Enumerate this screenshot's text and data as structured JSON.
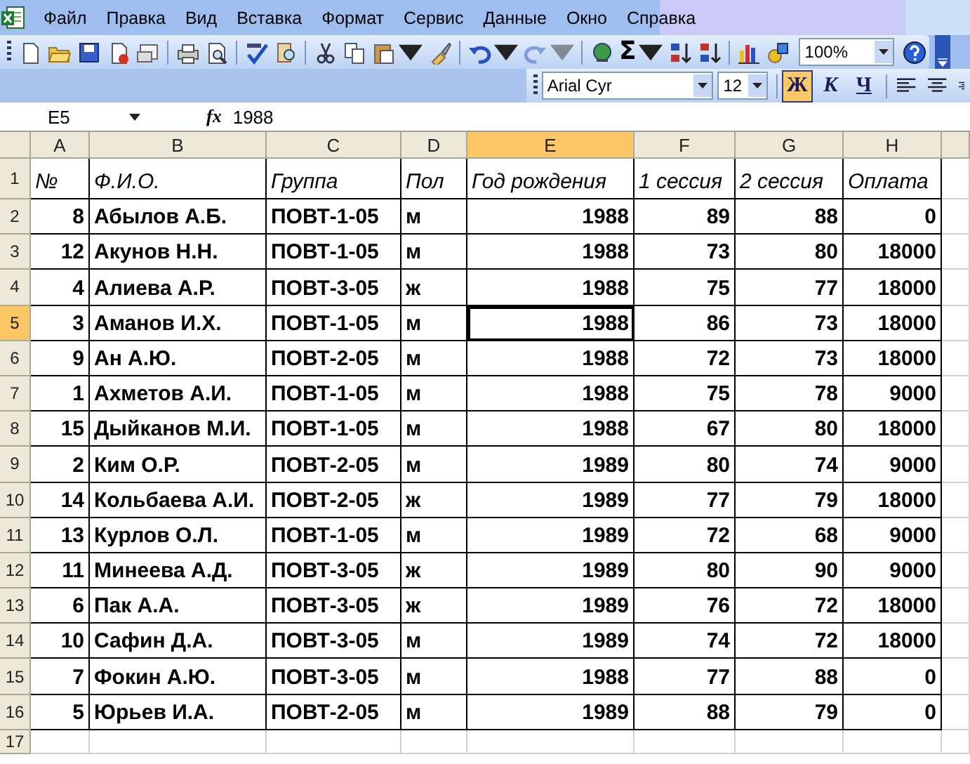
{
  "menu": [
    "Файл",
    "Правка",
    "Вид",
    "Вставка",
    "Формат",
    "Сервис",
    "Данные",
    "Окно",
    "Справка"
  ],
  "standard_toolbar": {
    "sum_symbol": "Σ",
    "redo": {
      "disabled": true
    },
    "zoom": "100%"
  },
  "formatting_toolbar": {
    "font": "Arial Cyr",
    "size": "12",
    "styles": [
      {
        "label": "Ж",
        "kind": "bold",
        "selected": true
      },
      {
        "label": "К",
        "kind": "italic",
        "selected": false
      },
      {
        "label": "Ч",
        "kind": "underline",
        "selected": false
      }
    ]
  },
  "formula_bar": {
    "name_box": "E5",
    "fx": "fx",
    "formula": "1988"
  },
  "columns": [
    {
      "label": "A",
      "numeric": true,
      "selected": false
    },
    {
      "label": "B",
      "numeric": false,
      "selected": false
    },
    {
      "label": "C",
      "numeric": false,
      "selected": false
    },
    {
      "label": "D",
      "numeric": false,
      "selected": false
    },
    {
      "label": "E",
      "numeric": true,
      "selected": true
    },
    {
      "label": "F",
      "numeric": true,
      "selected": false
    },
    {
      "label": "G",
      "numeric": true,
      "selected": false
    },
    {
      "label": "H",
      "numeric": true,
      "selected": false
    },
    {
      "selected": false
    }
  ],
  "rows": [
    {
      "header": "1",
      "kind": "header",
      "selected": false,
      "cells": [
        "№",
        "Ф.И.О.",
        "Группа",
        "Пол",
        "Год рождения",
        "1 сессия",
        "2 сессия",
        "Оплата"
      ]
    },
    {
      "header": "2",
      "kind": "data",
      "selected": false,
      "cells": [
        "8",
        "Абылов А.Б.",
        "ПОВТ-1-05",
        "м",
        "1988",
        "89",
        "88",
        "0"
      ]
    },
    {
      "header": "3",
      "kind": "data",
      "selected": false,
      "cells": [
        "12",
        "Акунов Н.Н.",
        "ПОВТ-1-05",
        "м",
        "1988",
        "73",
        "80",
        "18000"
      ]
    },
    {
      "header": "4",
      "kind": "data",
      "selected": false,
      "cells": [
        "4",
        "Алиева А.Р.",
        "ПОВТ-3-05",
        "ж",
        "1988",
        "75",
        "77",
        "18000"
      ]
    },
    {
      "header": "5",
      "kind": "data",
      "selected": true,
      "cells": [
        "3",
        "Аманов И.Х.",
        "ПОВТ-1-05",
        "м",
        "1988",
        "86",
        "73",
        "18000"
      ]
    },
    {
      "header": "6",
      "kind": "data",
      "selected": false,
      "cells": [
        "9",
        "Ан А.Ю.",
        "ПОВТ-2-05",
        "м",
        "1988",
        "72",
        "73",
        "18000"
      ]
    },
    {
      "header": "7",
      "kind": "data",
      "selected": false,
      "cells": [
        "1",
        "Ахметов А.И.",
        "ПОВТ-1-05",
        "м",
        "1988",
        "75",
        "78",
        "9000"
      ]
    },
    {
      "header": "8",
      "kind": "data",
      "selected": false,
      "cells": [
        "15",
        "Дыйканов М.И.",
        "ПОВТ-1-05",
        "м",
        "1988",
        "67",
        "80",
        "18000"
      ]
    },
    {
      "header": "9",
      "kind": "data",
      "selected": false,
      "cells": [
        "2",
        "Ким О.Р.",
        "ПОВТ-2-05",
        "м",
        "1989",
        "80",
        "74",
        "9000"
      ]
    },
    {
      "header": "10",
      "kind": "data",
      "selected": false,
      "cells": [
        "14",
        "Кольбаева А.И.",
        "ПОВТ-2-05",
        "ж",
        "1989",
        "77",
        "79",
        "18000"
      ]
    },
    {
      "header": "11",
      "kind": "data",
      "selected": false,
      "cells": [
        "13",
        "Курлов О.Л.",
        "ПОВТ-1-05",
        "м",
        "1989",
        "72",
        "68",
        "9000"
      ]
    },
    {
      "header": "12",
      "kind": "data",
      "selected": false,
      "cells": [
        "11",
        "Минеева А.Д.",
        "ПОВТ-3-05",
        "ж",
        "1989",
        "80",
        "90",
        "9000"
      ]
    },
    {
      "header": "13",
      "kind": "data",
      "selected": false,
      "cells": [
        "6",
        "Пак А.А.",
        "ПОВТ-3-05",
        "ж",
        "1989",
        "76",
        "72",
        "18000"
      ]
    },
    {
      "header": "14",
      "kind": "data",
      "selected": false,
      "cells": [
        "10",
        "Сафин Д.А.",
        "ПОВТ-3-05",
        "м",
        "1989",
        "74",
        "72",
        "18000"
      ]
    },
    {
      "header": "15",
      "kind": "data",
      "selected": false,
      "cells": [
        "7",
        "Фокин А.Ю.",
        "ПОВТ-3-05",
        "м",
        "1988",
        "77",
        "88",
        "0"
      ]
    },
    {
      "header": "16",
      "kind": "data",
      "selected": false,
      "cells": [
        "5",
        "Юрьев И.А.",
        "ПОВТ-2-05",
        "м",
        "1989",
        "88",
        "79",
        "0"
      ]
    },
    {
      "header": "17",
      "kind": "empty",
      "selected": false
    }
  ]
}
